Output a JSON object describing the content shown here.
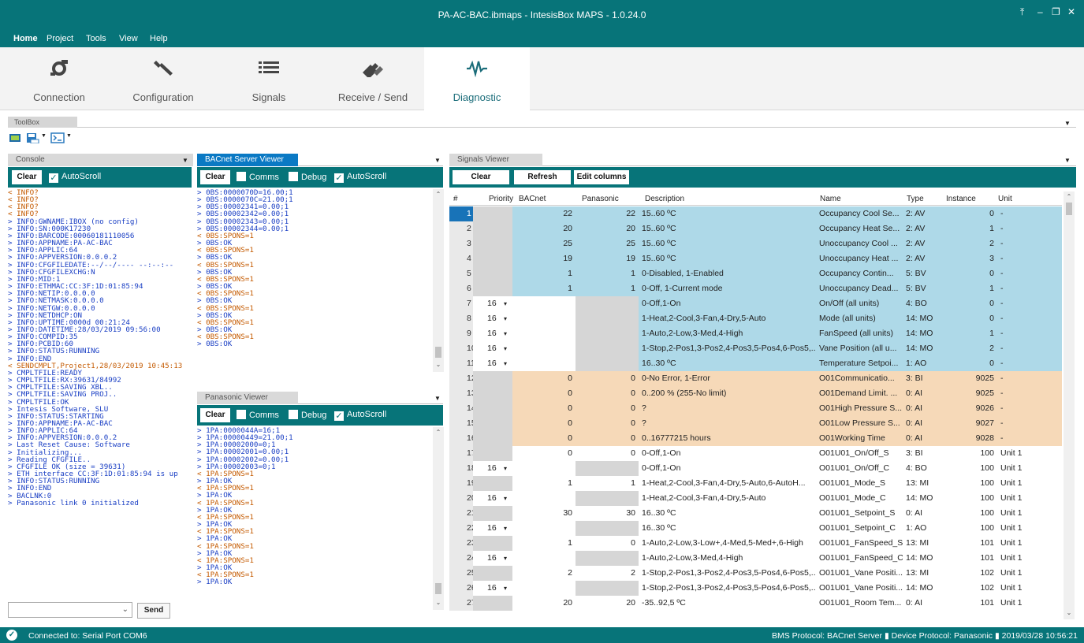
{
  "window": {
    "title": "PA-AC-BAC.ibmaps - IntesisBox MAPS - 1.0.24.0"
  },
  "menu": [
    "Home",
    "Project",
    "Tools",
    "View",
    "Help"
  ],
  "ribbon": [
    {
      "label": "Connection",
      "icon": "plug-icon"
    },
    {
      "label": "Configuration",
      "icon": "wrench-icon"
    },
    {
      "label": "Signals",
      "icon": "list-icon"
    },
    {
      "label": "Receive / Send",
      "icon": "transfer-icon"
    },
    {
      "label": "Diagnostic",
      "icon": "pulse-icon",
      "active": true
    }
  ],
  "toolbox": {
    "tab": "ToolBox"
  },
  "console": {
    "tab": "Console",
    "clear": "Clear",
    "autoscroll": "AutoScroll",
    "send": "Send",
    "lines": [
      "< INFO?",
      "< INFO?",
      "< INFO?",
      "< INFO?",
      "> INFO:GWNAME:IBOX (no config)",
      "> INFO:SN:000K17230",
      "> INFO:BARCODE:00060181110056",
      "> INFO:APPNAME:PA-AC-BAC",
      "> INFO:APPLIC:64",
      "> INFO:APPVERSION:0.0.0.2",
      "> INFO:CFGFILEDATE:--/--/---- --:--:--",
      "> INFO:CFGFILEXCHG:N",
      "> INFO:MID:1",
      "> INFO:ETHMAC:CC:3F:1D:01:85:94",
      "> INFO:NETIP:0.0.0.0",
      "> INFO:NETMASK:0.0.0.0",
      "> INFO:NETGW:0.0.0.0",
      "> INFO:NETDHCP:ON",
      "> INFO:UPTIME:0000d 00:21:24",
      "> INFO:DATETIME:28/03/2019 09:56:00",
      "> INFO:COMPID:35",
      "> INFO:PCBID:60",
      "> INFO:STATUS:RUNNING",
      "> INFO:END",
      "< SENDCMPLT,Project1,28/03/2019 10:45:13",
      "> CMPLTFILE:READY",
      "> CMPLTFILE:RX:39631/84992",
      "> CMPLTFILE:SAVING XBL..",
      "> CMPLTFILE:SAVING PROJ..",
      "> CMPLTFILE:OK",
      "> Intesis Software, SLU",
      "> INFO:STATUS:STARTING",
      "> INFO:APPNAME:PA-AC-BAC",
      "> INFO:APPLIC:64",
      "> INFO:APPVERSION:0.0.0.2",
      "> Last Reset Cause: Software",
      "> Initializing...",
      "> Reading CFGFILE..",
      "> CFGFILE OK (size = 39631)",
      "> ETH interface CC:3F:1D:01:85:94 is up",
      "> INFO:STATUS:RUNNING",
      "> INFO:END",
      "> BACLNK:0",
      "> Panasonic link 0 initialized"
    ]
  },
  "bacnet_viewer": {
    "tab": "BACnet Server Viewer",
    "clear": "Clear",
    "comms": "Comms",
    "debug": "Debug",
    "autoscroll": "AutoScroll",
    "lines": [
      "> 0BS:0000070D=16.00;1",
      "> 0BS:0000070C=21.00;1",
      "> 0BS:00002341=0.00;1",
      "> 0BS:00002342=0.00;1",
      "> 0BS:00002343=0.00;1",
      "> 0BS:00002344=0.00;1",
      "< 0BS:SPONS=1",
      "> 0BS:OK",
      "< 0BS:SPONS=1",
      "> 0BS:OK",
      "< 0BS:SPONS=1",
      "> 0BS:OK",
      "< 0BS:SPONS=1",
      "> 0BS:OK",
      "< 0BS:SPONS=1",
      "> 0BS:OK",
      "< 0BS:SPONS=1",
      "> 0BS:OK",
      "< 0BS:SPONS=1",
      "> 0BS:OK",
      "< 0BS:SPONS=1",
      "> 0BS:OK"
    ]
  },
  "panasonic_viewer": {
    "tab": "Panasonic Viewer",
    "clear": "Clear",
    "comms": "Comms",
    "debug": "Debug",
    "autoscroll": "AutoScroll",
    "lines": [
      "> 1PA:0000044A=16;1",
      "> 1PA:00000449=21.00;1",
      "> 1PA:00002000=0;1",
      "> 1PA:00002001=0.00;1",
      "> 1PA:00002002=0.00;1",
      "> 1PA:00002003=0;1",
      "< 1PA:SPONS=1",
      "> 1PA:OK",
      "< 1PA:SPONS=1",
      "> 1PA:OK",
      "< 1PA:SPONS=1",
      "> 1PA:OK",
      "< 1PA:SPONS=1",
      "> 1PA:OK",
      "< 1PA:SPONS=1",
      "> 1PA:OK",
      "< 1PA:SPONS=1",
      "> 1PA:OK",
      "< 1PA:SPONS=1",
      "> 1PA:OK",
      "< 1PA:SPONS=1",
      "> 1PA:OK"
    ]
  },
  "signals": {
    "tab": "Signals Viewer",
    "buttons": {
      "clear": "Clear",
      "refresh": "Refresh",
      "edit": "Edit columns"
    },
    "columns": [
      "#",
      "Priority",
      "BACnet",
      "Panasonic",
      "Description",
      "Name",
      "Type",
      "Instance",
      "Unit"
    ],
    "rows": [
      {
        "n": "1",
        "prio": "",
        "bac": "22",
        "pana": "22",
        "desc": "15..60 ºC",
        "name": "Occupancy Cool Se...",
        "type": "2: AV",
        "inst": "0",
        "unit": "-",
        "style": "blue"
      },
      {
        "n": "2",
        "prio": "",
        "bac": "20",
        "pana": "20",
        "desc": "15..60 ºC",
        "name": "Occupancy Heat Se...",
        "type": "2: AV",
        "inst": "1",
        "unit": "-",
        "style": "blue"
      },
      {
        "n": "3",
        "prio": "",
        "bac": "25",
        "pana": "25",
        "desc": "15..60 ºC",
        "name": "Unoccupancy Cool ...",
        "type": "2: AV",
        "inst": "2",
        "unit": "-",
        "style": "blue"
      },
      {
        "n": "4",
        "prio": "",
        "bac": "19",
        "pana": "19",
        "desc": "15..60 ºC",
        "name": "Unoccupancy Heat ...",
        "type": "2: AV",
        "inst": "3",
        "unit": "-",
        "style": "blue"
      },
      {
        "n": "5",
        "prio": "",
        "bac": "1",
        "pana": "1",
        "desc": "0-Disabled, 1-Enabled",
        "name": "Occupancy Contin...",
        "type": "5: BV",
        "inst": "0",
        "unit": "-",
        "style": "blue"
      },
      {
        "n": "6",
        "prio": "",
        "bac": "1",
        "pana": "1",
        "desc": "0-Off, 1-Current mode",
        "name": "Unoccupancy Dead...",
        "type": "5: BV",
        "inst": "1",
        "unit": "-",
        "style": "blue"
      },
      {
        "n": "7",
        "prio": "16",
        "bac": "",
        "pana": "",
        "desc": "0-Off,1-On",
        "name": "On/Off (all units)",
        "type": "4: BO",
        "inst": "0",
        "unit": "-",
        "style": "blue"
      },
      {
        "n": "8",
        "prio": "16",
        "bac": "",
        "pana": "",
        "desc": "1-Heat,2-Cool,3-Fan,4-Dry,5-Auto",
        "name": "Mode (all units)",
        "type": "14: MO",
        "inst": "0",
        "unit": "-",
        "style": "blue"
      },
      {
        "n": "9",
        "prio": "16",
        "bac": "",
        "pana": "",
        "desc": "1-Auto,2-Low,3-Med,4-High",
        "name": "FanSpeed (all units)",
        "type": "14: MO",
        "inst": "1",
        "unit": "-",
        "style": "blue"
      },
      {
        "n": "10",
        "prio": "16",
        "bac": "",
        "pana": "",
        "desc": "1-Stop,2-Pos1,3-Pos2,4-Pos3,5-Pos4,6-Pos5,...",
        "name": "Vane Position (all u...",
        "type": "14: MO",
        "inst": "2",
        "unit": "-",
        "style": "blue"
      },
      {
        "n": "11",
        "prio": "16",
        "bac": "",
        "pana": "",
        "desc": "16..30 ºC",
        "name": "Temperature Setpoi...",
        "type": "1: AO",
        "inst": "0",
        "unit": "-",
        "style": "blue"
      },
      {
        "n": "12",
        "prio": "",
        "bac": "0",
        "pana": "0",
        "desc": "0-No Error, 1-Error",
        "name": "O01Communicatio...",
        "type": "3: BI",
        "inst": "9025",
        "unit": "-",
        "style": "orange"
      },
      {
        "n": "13",
        "prio": "",
        "bac": "0",
        "pana": "0",
        "desc": "0..200 % (255-No limit)",
        "name": "O01Demand Limit. ...",
        "type": "0: AI",
        "inst": "9025",
        "unit": "-",
        "style": "orange"
      },
      {
        "n": "14",
        "prio": "",
        "bac": "0",
        "pana": "0",
        "desc": "?",
        "name": "O01High Pressure S...",
        "type": "0: AI",
        "inst": "9026",
        "unit": "-",
        "style": "orange"
      },
      {
        "n": "15",
        "prio": "",
        "bac": "0",
        "pana": "0",
        "desc": "?",
        "name": "O01Low Pressure S...",
        "type": "0: AI",
        "inst": "9027",
        "unit": "-",
        "style": "orange"
      },
      {
        "n": "16",
        "prio": "",
        "bac": "0",
        "pana": "0",
        "desc": "0..16777215 hours",
        "name": "O01Working Time",
        "type": "0: AI",
        "inst": "9028",
        "unit": "-",
        "style": "orange"
      },
      {
        "n": "17",
        "prio": "",
        "bac": "0",
        "pana": "0",
        "desc": "0-Off,1-On",
        "name": "O01U01_On/Off_S",
        "type": "3: BI",
        "inst": "100",
        "unit": "Unit 1",
        "style": "white"
      },
      {
        "n": "18",
        "prio": "16",
        "bac": "",
        "pana": "",
        "desc": "0-Off,1-On",
        "name": "O01U01_On/Off_C",
        "type": "4: BO",
        "inst": "100",
        "unit": "Unit 1",
        "style": "white"
      },
      {
        "n": "19",
        "prio": "",
        "bac": "1",
        "pana": "1",
        "desc": "1-Heat,2-Cool,3-Fan,4-Dry,5-Auto,6-AutoH...",
        "name": "O01U01_Mode_S",
        "type": "13: MI",
        "inst": "100",
        "unit": "Unit 1",
        "style": "white"
      },
      {
        "n": "20",
        "prio": "16",
        "bac": "",
        "pana": "",
        "desc": "1-Heat,2-Cool,3-Fan,4-Dry,5-Auto",
        "name": "O01U01_Mode_C",
        "type": "14: MO",
        "inst": "100",
        "unit": "Unit 1",
        "style": "white"
      },
      {
        "n": "21",
        "prio": "",
        "bac": "30",
        "pana": "30",
        "desc": "16..30 ºC",
        "name": "O01U01_Setpoint_S",
        "type": "0: AI",
        "inst": "100",
        "unit": "Unit 1",
        "style": "white"
      },
      {
        "n": "22",
        "prio": "16",
        "bac": "",
        "pana": "",
        "desc": "16..30 ºC",
        "name": "O01U01_Setpoint_C",
        "type": "1: AO",
        "inst": "100",
        "unit": "Unit 1",
        "style": "white"
      },
      {
        "n": "23",
        "prio": "",
        "bac": "1",
        "pana": "0",
        "desc": "1-Auto,2-Low,3-Low+,4-Med,5-Med+,6-High",
        "name": "O01U01_FanSpeed_S",
        "type": "13: MI",
        "inst": "101",
        "unit": "Unit 1",
        "style": "white"
      },
      {
        "n": "24",
        "prio": "16",
        "bac": "",
        "pana": "",
        "desc": "1-Auto,2-Low,3-Med,4-High",
        "name": "O01U01_FanSpeed_C",
        "type": "14: MO",
        "inst": "101",
        "unit": "Unit 1",
        "style": "white"
      },
      {
        "n": "25",
        "prio": "",
        "bac": "2",
        "pana": "2",
        "desc": "1-Stop,2-Pos1,3-Pos2,4-Pos3,5-Pos4,6-Pos5,...",
        "name": "O01U01_Vane Positi...",
        "type": "13: MI",
        "inst": "102",
        "unit": "Unit 1",
        "style": "white"
      },
      {
        "n": "26",
        "prio": "16",
        "bac": "",
        "pana": "",
        "desc": "1-Stop,2-Pos1,3-Pos2,4-Pos3,5-Pos4,6-Pos5,...",
        "name": "O01U01_Vane Positi...",
        "type": "14: MO",
        "inst": "102",
        "unit": "Unit 1",
        "style": "white"
      },
      {
        "n": "27",
        "prio": "",
        "bac": "20",
        "pana": "20",
        "desc": "-35..92,5 ºC",
        "name": "O01U01_Room Tem...",
        "type": "0: AI",
        "inst": "101",
        "unit": "Unit 1",
        "style": "white"
      }
    ]
  },
  "status": {
    "connection": "Connected to: Serial Port COM6",
    "right": "BMS Protocol: BACnet Server  ▮  Device Protocol: Panasonic  ▮  2019/03/28 10:56:21"
  }
}
